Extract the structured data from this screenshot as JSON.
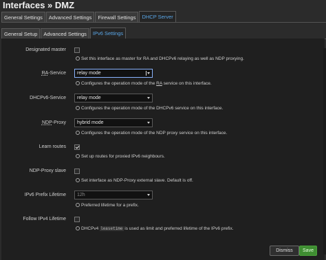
{
  "page": {
    "title": "Interfaces » DMZ"
  },
  "tabs_primary": [
    {
      "label": "General Settings"
    },
    {
      "label": "Advanced Settings"
    },
    {
      "label": "Firewall Settings"
    },
    {
      "label": "DHCP Server",
      "active": true
    }
  ],
  "tabs_secondary": [
    {
      "label": "General Setup"
    },
    {
      "label": "Advanced Settings"
    },
    {
      "label": "IPv6 Settings",
      "active": true
    }
  ],
  "fields": {
    "designated_master": {
      "label": "Designated master",
      "checked": false,
      "help": "Set this interface as master for RA and DHCPv6 relaying as well as NDP proxying."
    },
    "ra_service": {
      "label_prefix": "RA",
      "label_suffix": "-Service",
      "value": "relay mode",
      "help_prefix": "Configures the operation mode of the ",
      "help_abbr": "RA",
      "help_suffix": " service on this interface."
    },
    "dhcpv6_service": {
      "label": "DHCPv6-Service",
      "value": "relay mode",
      "help": "Configures the operation mode of the DHCPv6 service on this interface."
    },
    "ndp_proxy": {
      "label_prefix": "NDP",
      "label_suffix": "-Proxy",
      "value": "hybrid mode",
      "help": "Configures the operation mode of the NDP proxy service on this interface."
    },
    "learn_routes": {
      "label": "Learn routes",
      "checked": true,
      "help": "Set up routes for proxied IPv6 neighbours."
    },
    "ndp_proxy_slave": {
      "label": "NDP-Proxy slave",
      "checked": false,
      "help": "Set interface as NDP-Proxy external slave. Default is off."
    },
    "ipv6_prefix_lifetime": {
      "label": "IPv6 Prefix Lifetime",
      "value": "12h",
      "help": "Preferred lifetime for a prefix."
    },
    "follow_ipv4_lifetime": {
      "label": "Follow IPv4 Lifetime",
      "checked": false,
      "help_prefix": "DHCPv4 ",
      "help_code": "leasetime",
      "help_suffix": " is used as limit and preferred lifetime of the IPv6 prefix."
    }
  },
  "buttons": {
    "dismiss": "Dismiss",
    "save": "Save"
  },
  "colors": {
    "accent": "#5aa7e8",
    "save": "#3f8e32",
    "background": "#2b2b2b",
    "panel": "#1f1f1f"
  }
}
